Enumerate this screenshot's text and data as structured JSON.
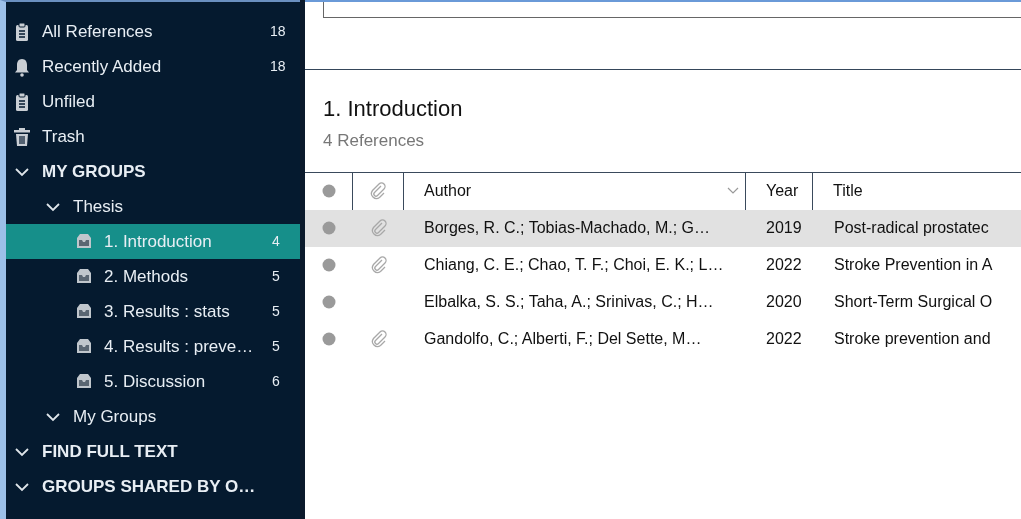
{
  "sidebar": {
    "items": [
      {
        "kind": "all_references",
        "label": "All References",
        "count": "18",
        "selected": false
      },
      {
        "kind": "recently_added",
        "label": "Recently Added",
        "count": "18",
        "selected": false
      },
      {
        "kind": "unfiled",
        "label": "Unfiled",
        "selected": false
      },
      {
        "kind": "trash",
        "label": "Trash",
        "selected": false
      },
      {
        "kind": "section",
        "label": "MY GROUPS",
        "expanded": true,
        "children": [
          {
            "kind": "group_set",
            "label": "Thesis",
            "expanded": true,
            "children": [
              {
                "kind": "group",
                "label": "1. Introduction",
                "count": "4",
                "selected": true
              },
              {
                "kind": "group",
                "label": "2. Methods",
                "count": "5",
                "selected": false
              },
              {
                "kind": "group",
                "label": "3. Results : stats",
                "count": "5",
                "selected": false
              },
              {
                "kind": "group",
                "label": "4. Results : preve…",
                "count": "5",
                "selected": false
              },
              {
                "kind": "group",
                "label": "5. Discussion",
                "count": "6",
                "selected": false
              }
            ]
          },
          {
            "kind": "group_set",
            "label": "My Groups",
            "expanded": true
          }
        ]
      },
      {
        "kind": "section",
        "label": "FIND FULL TEXT",
        "expanded": true
      },
      {
        "kind": "section",
        "label": "GROUPS SHARED BY O…",
        "expanded": true
      }
    ]
  },
  "main": {
    "title": "1. Introduction",
    "subtitle": "4 References",
    "table": {
      "columns": [
        {
          "kind": "read"
        },
        {
          "kind": "attachment"
        },
        {
          "kind": "text",
          "label": "Author",
          "sortable": true
        },
        {
          "kind": "text",
          "label": "Year"
        },
        {
          "kind": "text",
          "label": "Title"
        }
      ],
      "rows": [
        {
          "selected": true,
          "attachment": true,
          "author": "Borges, R. C.; Tobias-Machado, M.; G…",
          "year": "2019",
          "title": "Post-radical prostatec"
        },
        {
          "selected": false,
          "attachment": true,
          "author": "Chiang, C. E.; Chao, T. F.; Choi, E. K.; L…",
          "year": "2022",
          "title": "Stroke Prevention in A"
        },
        {
          "selected": false,
          "attachment": false,
          "author": "Elbalka, S. S.; Taha, A.; Srinivas, C.; H…",
          "year": "2020",
          "title": "Short-Term Surgical O"
        },
        {
          "selected": false,
          "attachment": true,
          "author": "Gandolfo, C.; Alberti, F.; Del Sette, M…",
          "year": "2022",
          "title": "Stroke prevention and"
        }
      ]
    }
  }
}
